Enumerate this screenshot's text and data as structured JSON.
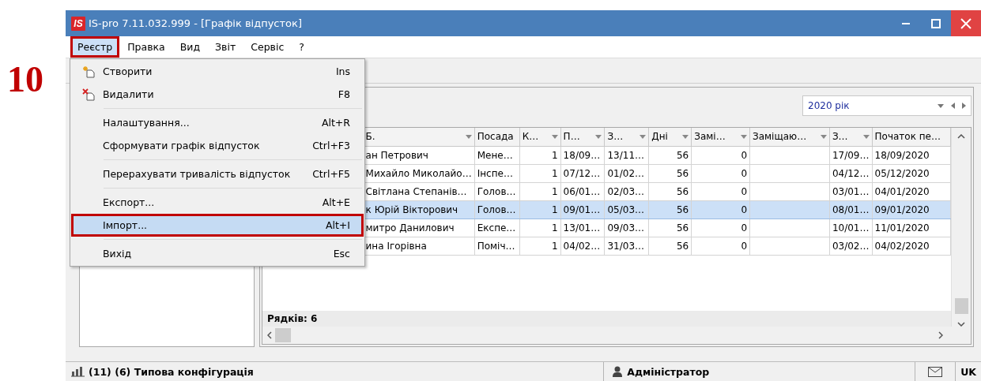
{
  "step": "10",
  "window": {
    "logo": "IS",
    "title": "IS-pro 7.11.032.999 - [Графік відпусток]"
  },
  "menubar": [
    {
      "label": "Реєстр",
      "selected": true,
      "outlined": true
    },
    {
      "label": "Правка",
      "selected": false,
      "outlined": false
    },
    {
      "label": "Вид",
      "selected": false,
      "outlined": false
    },
    {
      "label": "Звіт",
      "selected": false,
      "outlined": false
    },
    {
      "label": "Сервіс",
      "selected": false,
      "outlined": false
    },
    {
      "label": "?",
      "selected": false,
      "outlined": false
    }
  ],
  "menu": {
    "items": [
      {
        "kind": "new",
        "label": "Створити",
        "shortcut": "Ins",
        "selected": false,
        "outlined": false
      },
      {
        "kind": "delete",
        "label": "Видалити",
        "shortcut": "F8",
        "selected": false,
        "outlined": false
      },
      {
        "kind": "separator"
      },
      {
        "kind": "text",
        "label": "Налаштування...",
        "shortcut": "Alt+R",
        "selected": false,
        "outlined": false
      },
      {
        "kind": "text",
        "label": "Сформувати графік відпусток",
        "shortcut": "Ctrl+F3",
        "selected": false,
        "outlined": false
      },
      {
        "kind": "separator"
      },
      {
        "kind": "text",
        "label": "Перерахувати тривалість відпусток",
        "shortcut": "Ctrl+F5",
        "selected": false,
        "outlined": false
      },
      {
        "kind": "separator"
      },
      {
        "kind": "text",
        "label": "Експорт...",
        "shortcut": "Alt+E",
        "selected": false,
        "outlined": false
      },
      {
        "kind": "text",
        "label": "Імпорт...",
        "shortcut": "Alt+I",
        "selected": true,
        "outlined": true
      },
      {
        "kind": "separator"
      },
      {
        "kind": "text",
        "label": "Вихід",
        "shortcut": "Esc",
        "selected": false,
        "outlined": false
      }
    ]
  },
  "year_selector": {
    "value": "2020 рік"
  },
  "grid": {
    "columns": [
      {
        "label": "Б.",
        "kind": "text",
        "filter": true
      },
      {
        "label": "Посада",
        "kind": "text",
        "filter": false
      },
      {
        "label": "К…",
        "kind": "number",
        "filter": true
      },
      {
        "label": "П…",
        "kind": "text",
        "filter": true
      },
      {
        "label": "З…",
        "kind": "text",
        "filter": true
      },
      {
        "label": "Дні",
        "kind": "number",
        "filter": true
      },
      {
        "label": "Замі…",
        "kind": "number",
        "filter": true
      },
      {
        "label": "Заміщаю…",
        "kind": "text",
        "filter": true
      },
      {
        "label": "З…",
        "kind": "text",
        "filter": true
      },
      {
        "label": "Початок пе…",
        "kind": "text",
        "filter": false
      }
    ],
    "rows": [
      {
        "selected": false,
        "cells": [
          "ан Петрович",
          "Мене…",
          "1",
          "18/09…",
          "13/11…",
          "56",
          "0",
          null,
          "17/09…",
          "18/09/2020"
        ]
      },
      {
        "selected": false,
        "cells": [
          "Михайло Миколайо…",
          "Інспе…",
          "1",
          "07/12…",
          "01/02…",
          "56",
          "0",
          null,
          "04/12…",
          "05/12/2020"
        ]
      },
      {
        "selected": false,
        "cells": [
          "Світлана Степанів…",
          "Голов…",
          "1",
          "06/01…",
          "02/03…",
          "56",
          "0",
          null,
          "03/01…",
          "04/01/2020"
        ]
      },
      {
        "selected": true,
        "cells": [
          "к Юрій Вікторович",
          "Голов…",
          "1",
          "09/01…",
          "05/03…",
          "56",
          "0",
          null,
          "08/01…",
          "09/01/2020"
        ]
      },
      {
        "selected": false,
        "cells": [
          "митро Данилович",
          "Експе…",
          "1",
          "13/01…",
          "09/03…",
          "56",
          "0",
          null,
          "10/01…",
          "11/01/2020"
        ]
      },
      {
        "selected": false,
        "cells": [
          "ина Ігорівна",
          "Поміч…",
          "1",
          "04/02…",
          "31/03…",
          "56",
          "0",
          null,
          "03/02…",
          "04/02/2020"
        ]
      }
    ],
    "footer": "Рядків: 6"
  },
  "status_bar": {
    "config": "(11) (6) Типова конфігурація",
    "user": "Адміністратор",
    "language": "UK"
  }
}
